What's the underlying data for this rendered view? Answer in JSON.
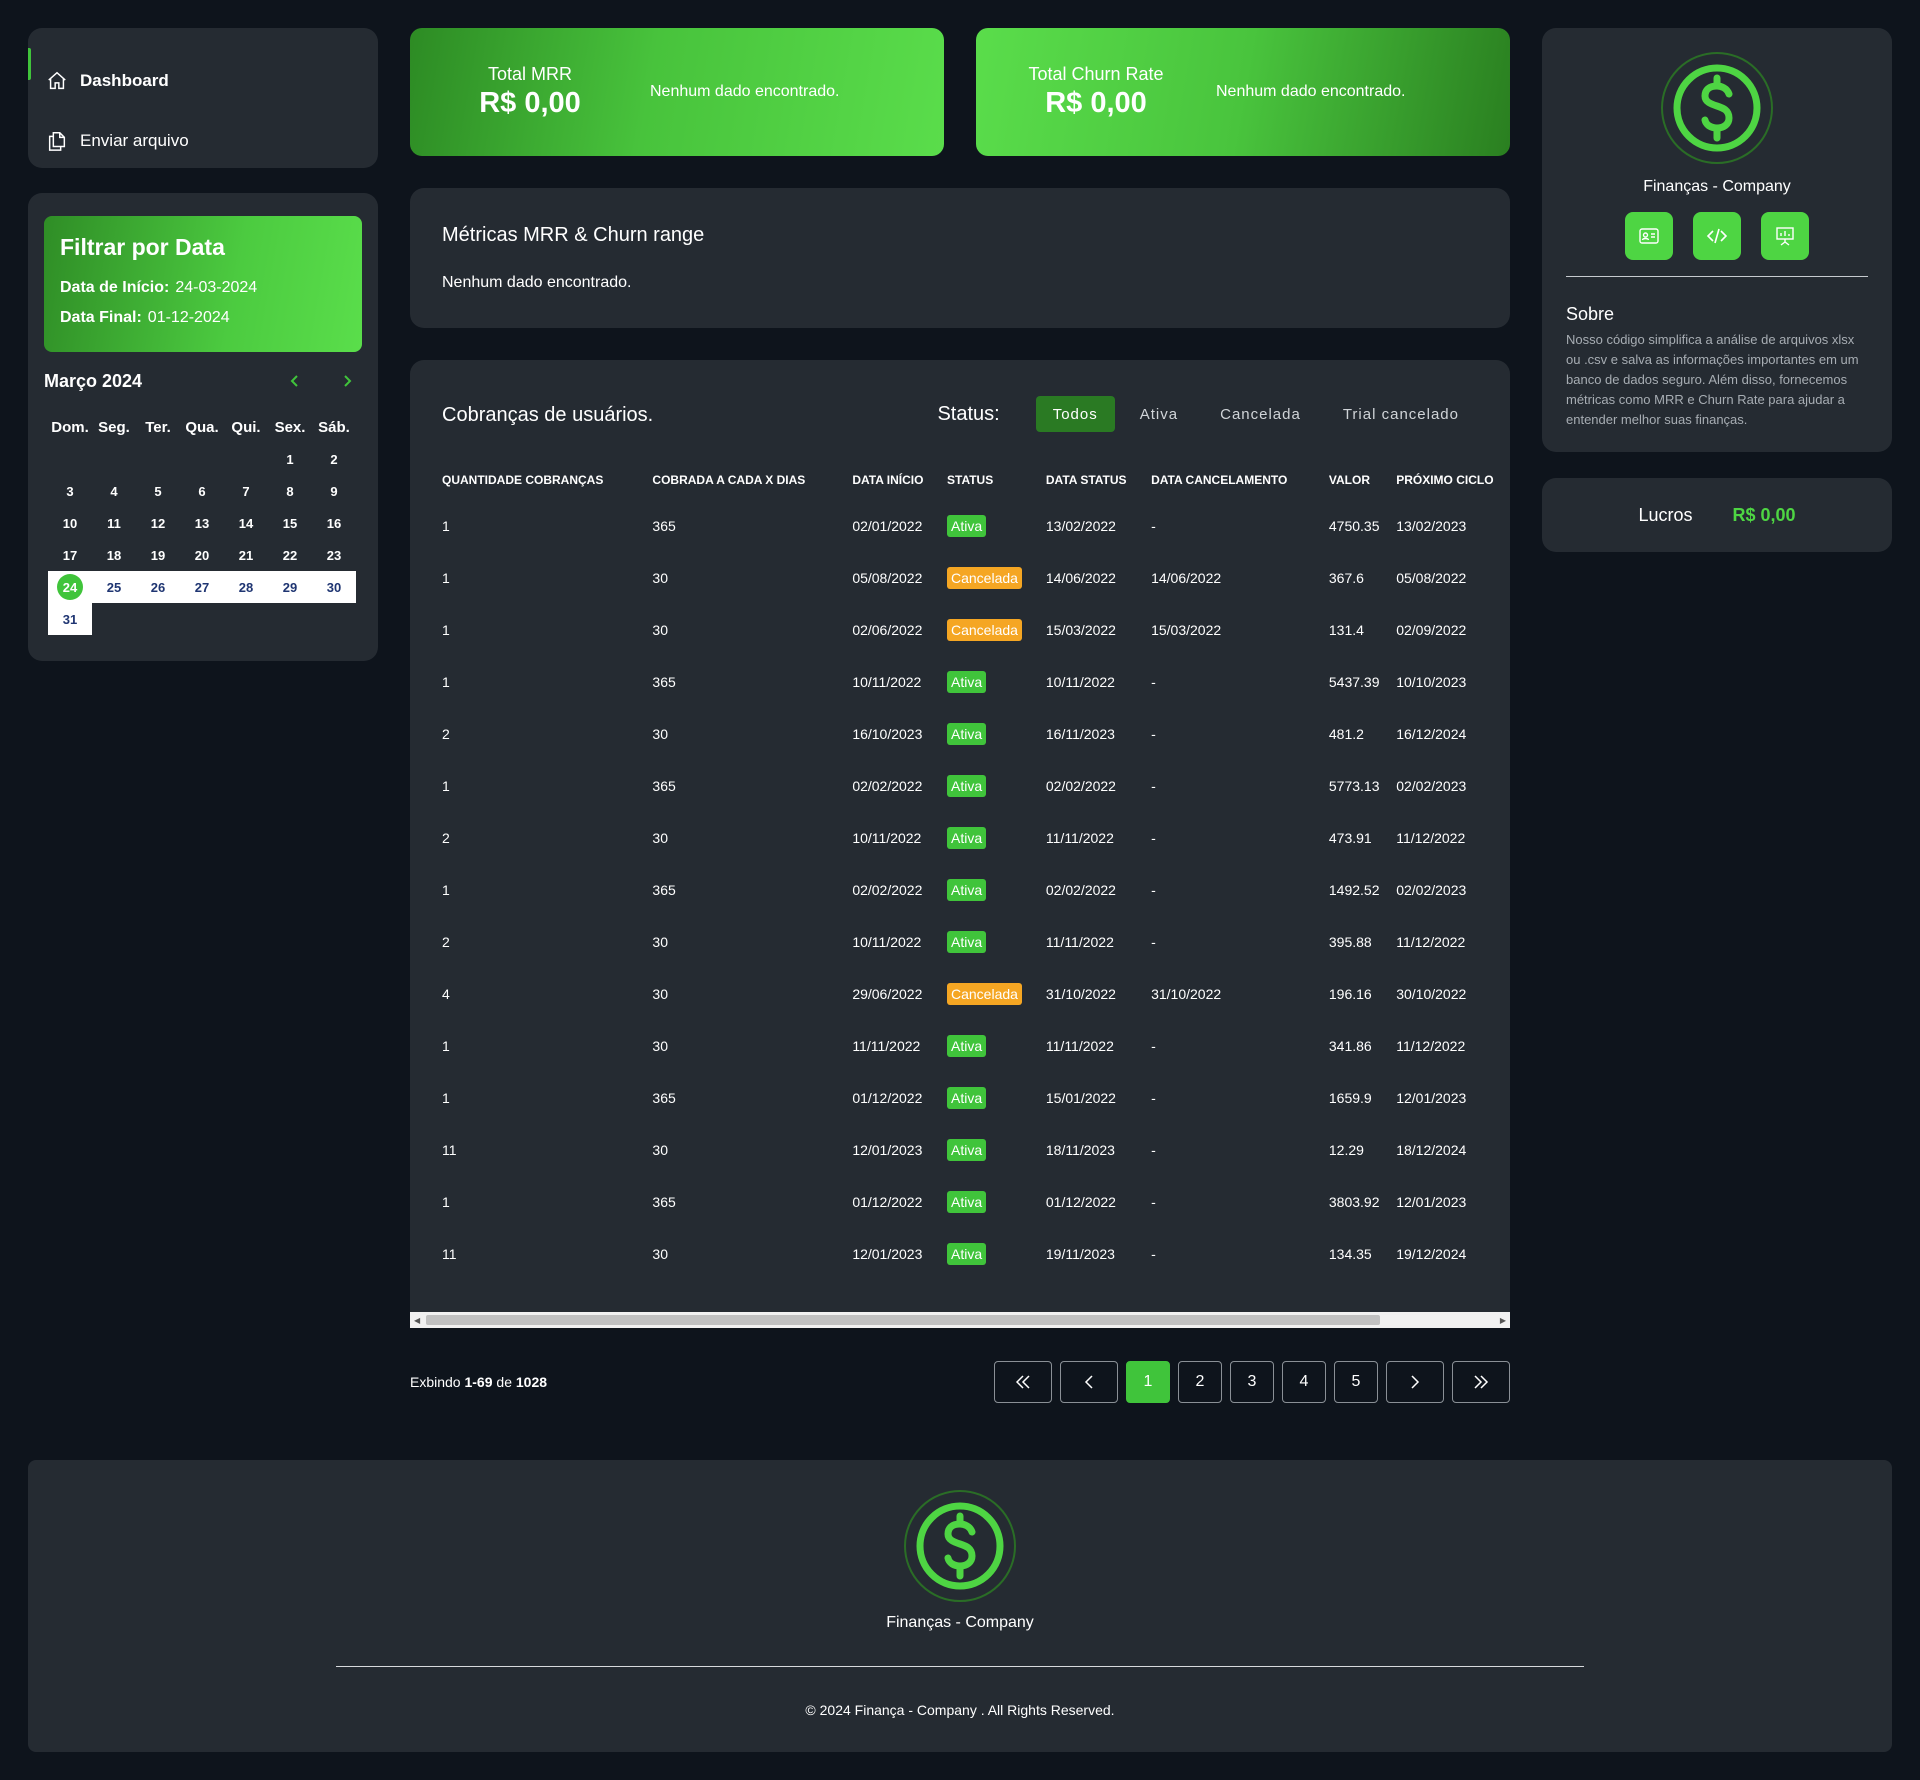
{
  "nav": {
    "items": [
      {
        "label": "Dashboard",
        "icon": "home-icon"
      },
      {
        "label": "Enviar arquivo",
        "icon": "files-icon"
      }
    ]
  },
  "filter": {
    "title": "Filtrar por Data",
    "start_label": "Data de Início:",
    "start_value": "24-03-2024",
    "end_label": "Data Final:",
    "end_value": "01-12-2024"
  },
  "calendar": {
    "month": "Março 2024",
    "dow": [
      "Dom.",
      "Seg.",
      "Ter.",
      "Qua.",
      "Qui.",
      "Sex.",
      "Sáb."
    ],
    "first_weekday": 5,
    "days_in_month": 31,
    "today": 24,
    "selected_from": 24
  },
  "kpis": {
    "mrr": {
      "label": "Total MRR",
      "value": "R$ 0,00",
      "empty": "Nenhum dado encontrado."
    },
    "churn": {
      "label": "Total Churn Rate",
      "value": "R$ 0,00",
      "empty": "Nenhum dado encontrado."
    }
  },
  "metrics": {
    "title": "Métricas MRR & Churn range",
    "empty": "Nenhum dado encontrado."
  },
  "charges": {
    "title": "Cobranças de usuários.",
    "status_label": "Status:",
    "status_options": [
      "Todos",
      "Ativa",
      "Cancelada",
      "Trial cancelado"
    ],
    "active_status": "Todos",
    "columns": [
      "QUANTIDADE COBRANÇAS",
      "COBRADA A CADA X DIAS",
      "DATA INÍCIO",
      "STATUS",
      "DATA STATUS",
      "DATA CANCELAMENTO",
      "VALOR",
      "PRÓXIMO CICLO"
    ],
    "rows": [
      [
        "1",
        "365",
        "02/01/2022",
        "Ativa",
        "13/02/2022",
        "-",
        "4750.35",
        "13/02/2023"
      ],
      [
        "1",
        "30",
        "05/08/2022",
        "Cancelada",
        "14/06/2022",
        "14/06/2022",
        "367.6",
        "05/08/2022"
      ],
      [
        "1",
        "30",
        "02/06/2022",
        "Cancelada",
        "15/03/2022",
        "15/03/2022",
        "131.4",
        "02/09/2022"
      ],
      [
        "1",
        "365",
        "10/11/2022",
        "Ativa",
        "10/11/2022",
        "-",
        "5437.39",
        "10/10/2023"
      ],
      [
        "2",
        "30",
        "16/10/2023",
        "Ativa",
        "16/11/2023",
        "-",
        "481.2",
        "16/12/2024"
      ],
      [
        "1",
        "365",
        "02/02/2022",
        "Ativa",
        "02/02/2022",
        "-",
        "5773.13",
        "02/02/2023"
      ],
      [
        "2",
        "30",
        "10/11/2022",
        "Ativa",
        "11/11/2022",
        "-",
        "473.91",
        "11/12/2022"
      ],
      [
        "1",
        "365",
        "02/02/2022",
        "Ativa",
        "02/02/2022",
        "-",
        "1492.52",
        "02/02/2023"
      ],
      [
        "2",
        "30",
        "10/11/2022",
        "Ativa",
        "11/11/2022",
        "-",
        "395.88",
        "11/12/2022"
      ],
      [
        "4",
        "30",
        "29/06/2022",
        "Cancelada",
        "31/10/2022",
        "31/10/2022",
        "196.16",
        "30/10/2022"
      ],
      [
        "1",
        "30",
        "11/11/2022",
        "Ativa",
        "11/11/2022",
        "-",
        "341.86",
        "11/12/2022"
      ],
      [
        "1",
        "365",
        "01/12/2022",
        "Ativa",
        "15/01/2022",
        "-",
        "1659.9",
        "12/01/2023"
      ],
      [
        "11",
        "30",
        "12/01/2023",
        "Ativa",
        "18/11/2023",
        "-",
        "12.29",
        "18/12/2024"
      ],
      [
        "1",
        "365",
        "01/12/2022",
        "Ativa",
        "01/12/2022",
        "-",
        "3803.92",
        "12/01/2023"
      ],
      [
        "11",
        "30",
        "12/01/2023",
        "Ativa",
        "19/11/2023",
        "-",
        "134.35",
        "19/12/2024"
      ]
    ]
  },
  "pagination": {
    "showing_prefix": "Exbindo",
    "range": "1-69",
    "of": "de",
    "total": "1028",
    "pages": [
      "1",
      "2",
      "3",
      "4",
      "5"
    ],
    "current": "1"
  },
  "profile": {
    "name": "Finanças - Company",
    "buttons": [
      "id-card-icon",
      "code-icon",
      "presentation-icon"
    ],
    "about_title": "Sobre",
    "about_text": "Nosso código simplifica a análise de arquivos xlsx ou .csv e salva as informações importantes em um banco de dados seguro. Além disso, fornecemos métricas como MRR e Churn Rate para ajudar a entender melhor suas finanças."
  },
  "profit": {
    "label": "Lucros",
    "value": "R$ 0,00"
  },
  "footer": {
    "name": "Finanças - Company",
    "copyright": "© 2024 Finança - Company . All Rights Reserved."
  },
  "colors": {
    "accent": "#40c43b",
    "warning": "#f5a623",
    "panel": "#252b32",
    "background": "#0e141c"
  }
}
